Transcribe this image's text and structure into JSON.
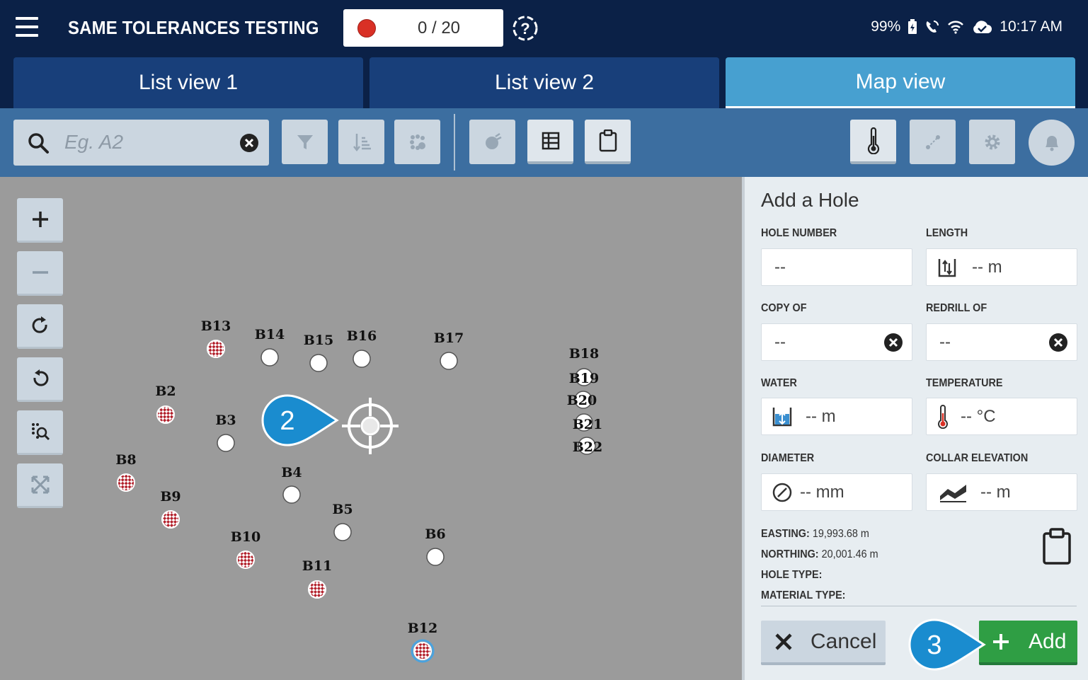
{
  "header": {
    "title": "SAME TOLERANCES TESTING",
    "progress": "0 / 20",
    "battery": "99%",
    "time": "10:17 AM"
  },
  "tabs": [
    {
      "label": "List view 1"
    },
    {
      "label": "List view 2"
    },
    {
      "label": "Map view",
      "active": true
    }
  ],
  "search": {
    "placeholder": "Eg. A2",
    "value": ""
  },
  "map": {
    "holes": [
      {
        "id": "B13",
        "style": "checker"
      },
      {
        "id": "B14",
        "style": "open"
      },
      {
        "id": "B15",
        "style": "open"
      },
      {
        "id": "B16",
        "style": "open"
      },
      {
        "id": "B17",
        "style": "open"
      },
      {
        "id": "B18",
        "style": "open"
      },
      {
        "id": "B19",
        "style": "open"
      },
      {
        "id": "B20",
        "style": "open"
      },
      {
        "id": "B21",
        "style": "open"
      },
      {
        "id": "B22",
        "style": "open"
      },
      {
        "id": "B2",
        "style": "checker"
      },
      {
        "id": "B3",
        "style": "open"
      },
      {
        "id": "B8",
        "style": "checker"
      },
      {
        "id": "B9",
        "style": "checker"
      },
      {
        "id": "B4",
        "style": "open"
      },
      {
        "id": "B5",
        "style": "open"
      },
      {
        "id": "B10",
        "style": "checker"
      },
      {
        "id": "B11",
        "style": "checker"
      },
      {
        "id": "B6",
        "style": "open"
      },
      {
        "id": "B12",
        "style": "checker-selected"
      }
    ]
  },
  "panel": {
    "title": "Add a Hole",
    "labels": {
      "hole_number": "HOLE NUMBER",
      "length": "LENGTH",
      "copy_of": "COPY OF",
      "redrill_of": "REDRILL OF",
      "water": "WATER",
      "temperature": "TEMPERATURE",
      "diameter": "DIAMETER",
      "collar_elevation": "COLLAR ELEVATION"
    },
    "values": {
      "hole_number": "--",
      "length": "-- m",
      "copy_of": "--",
      "redrill_of": "--",
      "water": "-- m",
      "temperature": "-- °C",
      "diameter": "-- mm",
      "collar_elevation": "-- m"
    },
    "info": {
      "easting_label": "EASTING:",
      "easting_value": "19,993.68 m",
      "northing_label": "NORTHING:",
      "northing_value": "20,001.46 m",
      "hole_type_label": "HOLE TYPE:",
      "hole_type_value": "",
      "material_type_label": "MATERIAL TYPE:",
      "material_type_value": ""
    },
    "cancel_label": "Cancel",
    "add_label": "Add"
  },
  "callouts": [
    {
      "number": "2"
    },
    {
      "number": "3"
    }
  ],
  "colors": {
    "header_bg": "#0b2147",
    "tab_bg": "#183f7a",
    "tab_active": "#47a0d0",
    "toolbar_bg": "#3c6ea0",
    "add_green": "#2f9e44",
    "callout_blue": "#1a8ccf",
    "record_red": "#d93025"
  }
}
